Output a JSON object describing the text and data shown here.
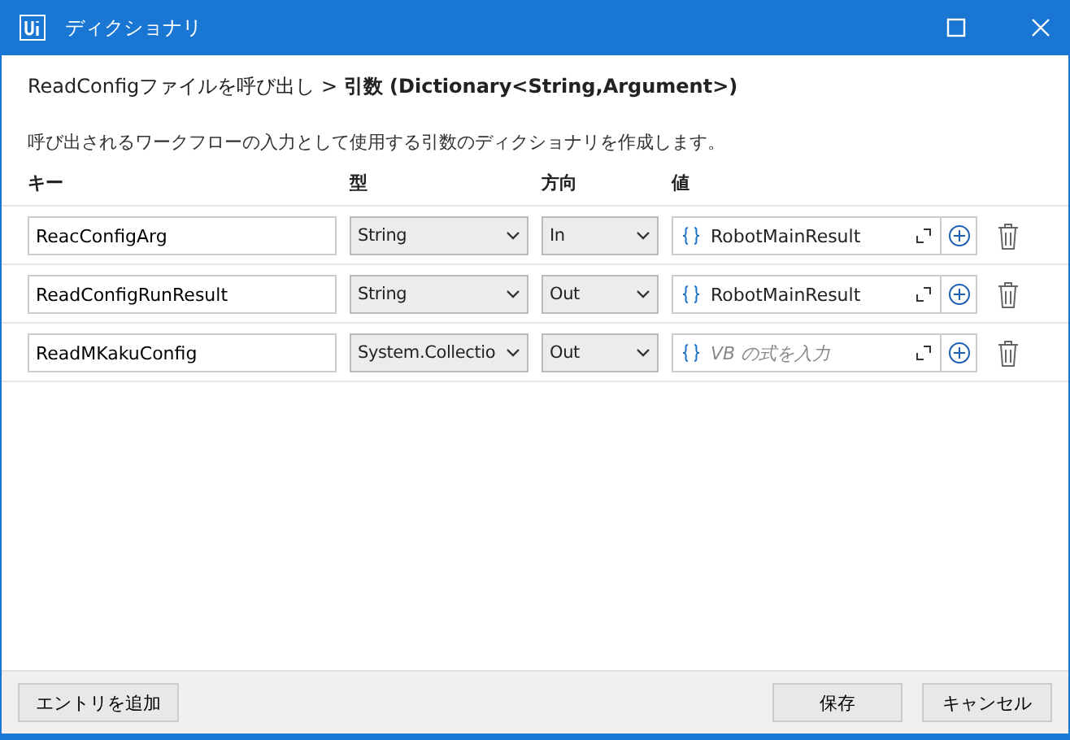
{
  "window": {
    "title": "ディクショナリ"
  },
  "breadcrumb": "ReadConfigファイルを呼び出し  >  **引数 (Dictionary<String,Argument>)**",
  "description": "呼び出されるワークフローの入力として使用する引数のディクショナリを作成します。",
  "columns": [
    "キー",
    "型",
    "方向",
    "値"
  ],
  "rows": [
    {
      "key": "ReacConfigArg",
      "type": "String",
      "direction": "In",
      "value": "RobotMainResult"
    },
    {
      "key": "ReadConfigRunResult",
      "type": "String",
      "direction": "Out",
      "value": "RobotMainResult"
    },
    {
      "key": "ReadMKakuConfig",
      "type": "System.Collectio",
      "direction": "Out",
      "placeholder": "VB の式を入力"
    }
  ],
  "footer": {
    "add_button": "エントリを追加",
    "buttons": [
      "保存",
      "キャンセル"
    ]
  }
}
